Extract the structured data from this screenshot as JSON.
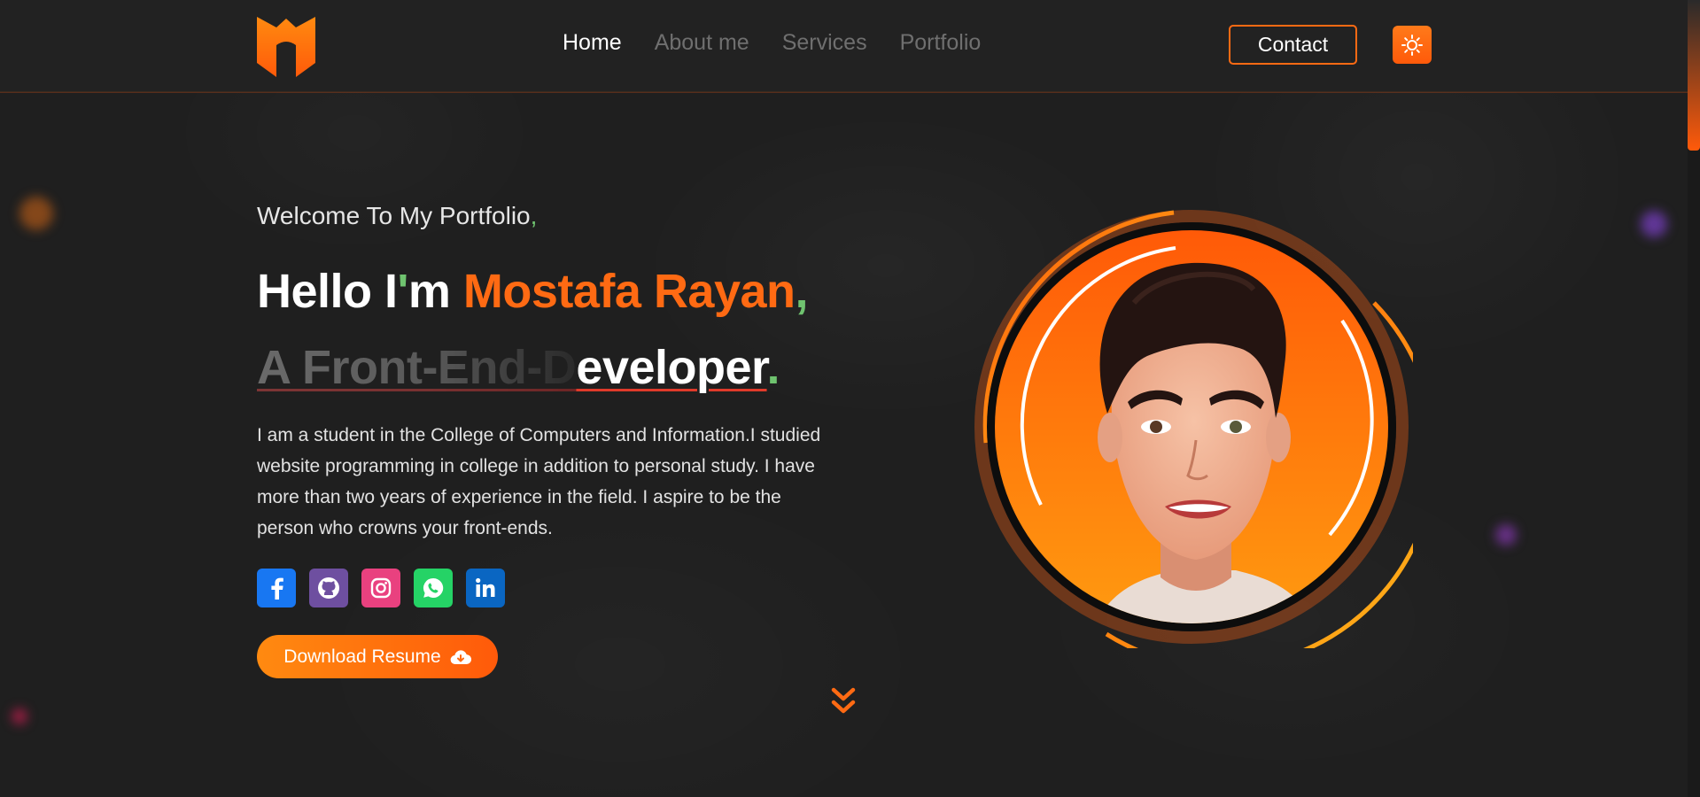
{
  "nav": {
    "items": [
      {
        "label": "Home",
        "active": true
      },
      {
        "label": "About me",
        "active": false
      },
      {
        "label": "Services",
        "active": false
      },
      {
        "label": "Portfolio",
        "active": false
      }
    ],
    "contact_label": "Contact"
  },
  "hero": {
    "welcome": "Welcome To My Portfolio",
    "welcome_punct": ",",
    "hello_prefix": "Hello I",
    "hello_apostrophe": "'",
    "hello_mid": "m ",
    "name": "Mostafa Rayan",
    "name_punct": ",",
    "role_faded": "A Front-End-D",
    "role_typed": "eveloper",
    "role_punct": ".",
    "bio": "I am a student in the College of Computers and Information.I studied website programming in college in addition to personal study. I have more than two years of experience in the field. I aspire to be the person who crowns your front-ends.",
    "resume_label": "Download Resume"
  },
  "socials": [
    {
      "name": "facebook",
      "icon": "facebook-icon",
      "color": "#1877f2"
    },
    {
      "name": "github",
      "icon": "github-icon",
      "color": "#6e4fa0"
    },
    {
      "name": "instagram",
      "icon": "instagram-icon",
      "color": "#e9417f"
    },
    {
      "name": "whatsapp",
      "icon": "whatsapp-icon",
      "color": "#25d366"
    },
    {
      "name": "linkedin",
      "icon": "linkedin-icon",
      "color": "#0a66c2"
    }
  ],
  "colors": {
    "accent": "#ff6a13",
    "background": "#1f1f1f",
    "highlight_green": "#6fc36f"
  }
}
